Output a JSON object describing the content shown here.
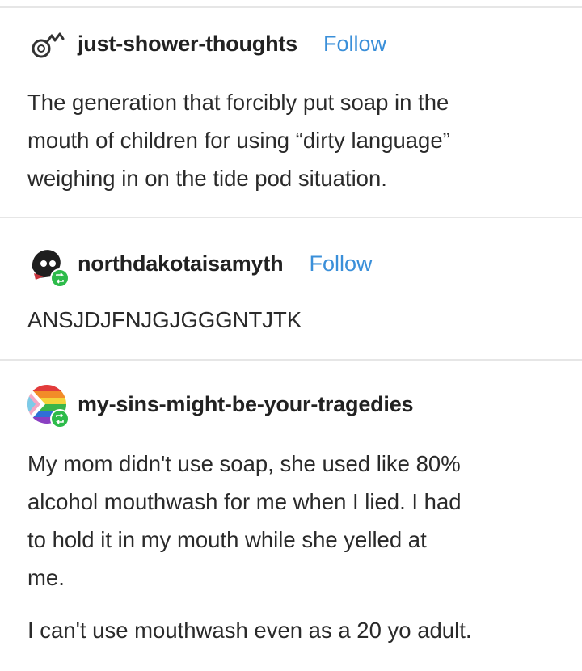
{
  "posts": [
    {
      "username": "just-shower-thoughts",
      "follow_label": "Follow",
      "lines": [
        "The generation that forcibly put soap in the",
        "mouth of children for using “dirty language”",
        "weighing in on the tide pod situation."
      ]
    },
    {
      "username": "northdakotaisamyth",
      "follow_label": "Follow",
      "lines": [
        "ANSJDJFNJGJGGGNTJTK"
      ]
    },
    {
      "username": "my-sins-might-be-your-tragedies",
      "lines": [
        "My mom didn't use soap, she used like 80%",
        "alcohol mouthwash for me when I lied. I had",
        "to hold it in my mouth while she yelled at",
        "me.",
        "I can't use mouthwash even as a 20 yo adult."
      ]
    }
  ],
  "colors": {
    "follow": "#3a8fd9",
    "reblog_badge": "#2dbb4a",
    "divider": "#e6e6e6"
  },
  "icons": [
    "lightbulb-avatar-icon",
    "skull-avatar-icon",
    "pride-flag-avatar-icon",
    "reblog-icon"
  ]
}
